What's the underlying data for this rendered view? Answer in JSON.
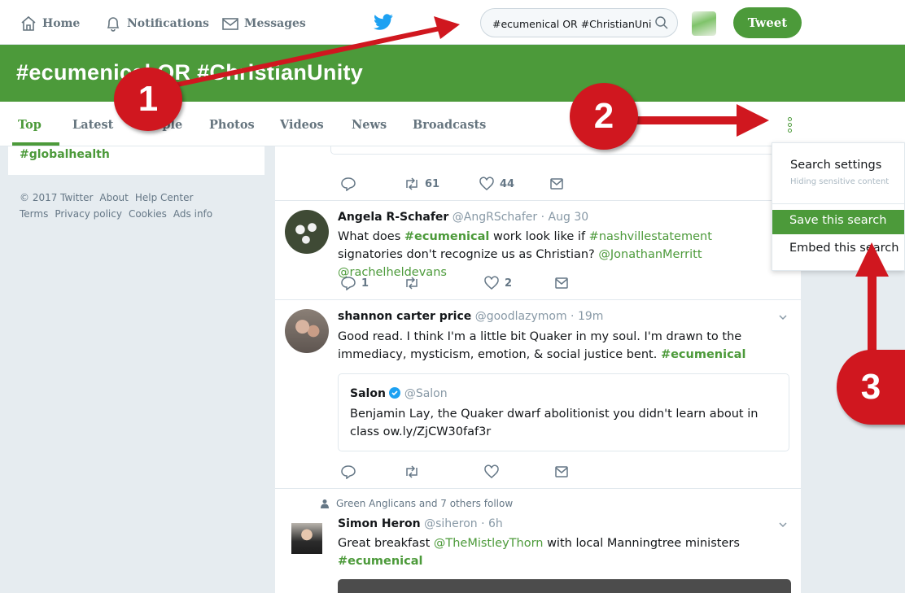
{
  "nav": {
    "home": "Home",
    "notifications": "Notifications",
    "messages": "Messages",
    "logo_icon": "twitter-bird-icon",
    "tweet_button": "Tweet"
  },
  "search": {
    "value": "#ecumenical OR #ChristianUni",
    "icon": "search-icon"
  },
  "header": {
    "title": "#ecumenical OR #ChristianUnity"
  },
  "tabs": [
    "Top",
    "Latest",
    "People",
    "Photos",
    "Videos",
    "News",
    "Broadcasts"
  ],
  "sidebar": {
    "trend": "#globalhealth",
    "footer_line1": [
      "© 2017 Twitter",
      "About",
      "Help Center"
    ],
    "footer_line2": [
      "Terms",
      "Privacy policy",
      "Cookies",
      "Ads info"
    ]
  },
  "tweets": [
    {
      "actions": {
        "reply": "",
        "retweet": "61",
        "like": "44"
      }
    },
    {
      "name": "Angela R-Schafer",
      "handle": "@AngRSchafer",
      "time": "· Aug 30",
      "text_parts": [
        "What does ",
        "#ecumenical",
        " work look like if ",
        "#nashvillestatement",
        " signatories don't recognize us as Christian? ",
        "@JonathanMerritt",
        " ",
        "@rachelheldevans"
      ],
      "actions": {
        "reply": "1",
        "retweet": "",
        "like": "2"
      }
    },
    {
      "name": "shannon carter price",
      "handle": "@goodlazymom",
      "time": "· 19m",
      "text_parts": [
        "Good read. I think I'm a little bit Quaker in my soul. I'm drawn to the immediacy, mysticism, emotion, & social justice bent. ",
        "#ecumenical"
      ],
      "quote": {
        "name": "Salon",
        "handle": "@Salon",
        "text": "Benjamin Lay, the Quaker dwarf abolitionist you didn't learn about in class ow.ly/ZjCW30faf3r"
      }
    },
    {
      "social_context": "Green Anglicans and 7 others follow",
      "name": "Simon Heron",
      "handle": "@siheron",
      "time": "· 6h",
      "text_parts": [
        "Great breakfast ",
        "@TheMistleyThorn",
        " with local Manningtree ministers ",
        "#ecumenical"
      ]
    }
  ],
  "dropdown": {
    "search_settings": "Search settings",
    "search_settings_sub": "Hiding sensitive content",
    "save_search": "Save this search",
    "embed_search": "Embed this search"
  },
  "callouts": [
    "1",
    "2",
    "3"
  ],
  "colors": {
    "accent": "#4c9a3a",
    "callout_red": "#d0171f",
    "twitter_blue": "#1da1f2",
    "background": "#e6ecf0"
  }
}
